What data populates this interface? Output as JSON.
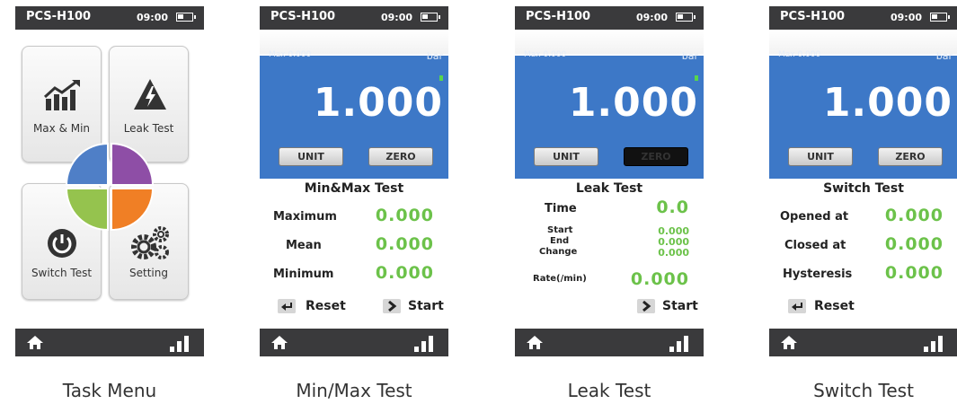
{
  "device": {
    "model": "PCS-H100",
    "time": "09:00"
  },
  "captions": [
    "Task Menu",
    "Min/Max Test",
    "Leak Test",
    "Switch Test"
  ],
  "task_menu": {
    "tiles": [
      "Max & Min",
      "Leak Test",
      "Switch Test",
      "Setting"
    ],
    "quadrant_colors": [
      "#4f7fc7",
      "#8e4ea6",
      "#95c34e",
      "#f07f25"
    ]
  },
  "meter": {
    "max_label": "Max 0.000",
    "unit": "bar",
    "value": "1.000",
    "unit_button": "UNIT",
    "zero_button": "ZERO"
  },
  "minmax": {
    "title": "Min&Max Test",
    "rows": [
      {
        "label": "Maximum",
        "value": "0.000"
      },
      {
        "label": "Mean",
        "value": "0.000"
      },
      {
        "label": "Minimum",
        "value": "0.000"
      }
    ],
    "reset": "Reset",
    "start": "Start"
  },
  "leak": {
    "title": "Leak Test",
    "time_label": "Time",
    "time_value": "0.0",
    "details": [
      {
        "label": "Start",
        "value": "0.000"
      },
      {
        "label": "End",
        "value": "0.000"
      },
      {
        "label": "Change",
        "value": "0.000"
      }
    ],
    "rate_label": "Rate(/min)",
    "rate_value": "0.000",
    "start": "Start"
  },
  "switch": {
    "title": "Switch Test",
    "rows": [
      {
        "label": "Opened at",
        "value": "0.000"
      },
      {
        "label": "Closed at",
        "value": "0.000"
      },
      {
        "label": "Hysteresis",
        "value": "0.000"
      }
    ],
    "reset": "Reset"
  },
  "colors": {
    "status_bar": "#3a3a3c",
    "meter_bg": "#3d78c7",
    "value_green": "#6cc24a"
  },
  "icons": [
    "battery-icon",
    "home-icon",
    "signal-icon",
    "chart-up-icon",
    "lightning-triangle-icon",
    "power-icon",
    "gears-icon",
    "back-arrow-icon",
    "play-chevron-icon"
  ]
}
